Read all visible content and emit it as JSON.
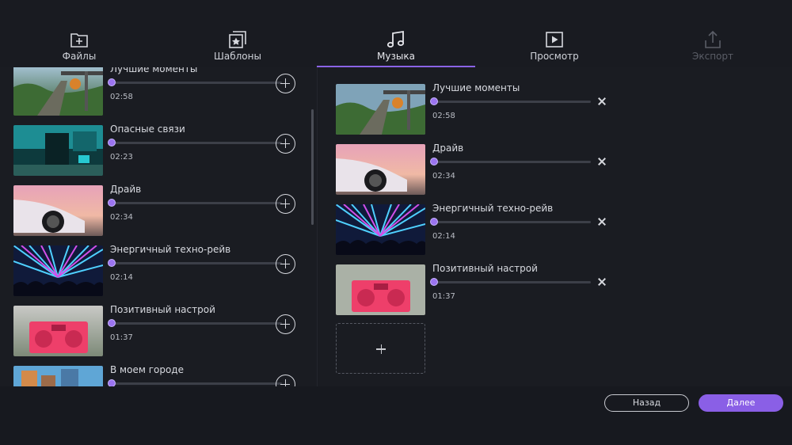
{
  "colors": {
    "accent": "#8a63e6",
    "background": "#17191f",
    "panel": "#1a1c22"
  },
  "tabs": [
    {
      "label": "Файлы",
      "icon": "file-add-icon",
      "state": "normal"
    },
    {
      "label": "Шаблоны",
      "icon": "templates-icon",
      "state": "normal"
    },
    {
      "label": "Музыка",
      "icon": "music-note-icon",
      "state": "active"
    },
    {
      "label": "Просмотр",
      "icon": "play-preview-icon",
      "state": "normal"
    },
    {
      "label": "Экспорт",
      "icon": "export-icon",
      "state": "disabled"
    }
  ],
  "library": {
    "tracks": [
      {
        "title": "Лучшие моменты",
        "duration": "02:58",
        "thumb": "train-thumb",
        "progress": 0
      },
      {
        "title": "Опасные связи",
        "duration": "02:23",
        "thumb": "building-thumb",
        "progress": 0
      },
      {
        "title": "Драйв",
        "duration": "02:34",
        "thumb": "car-thumb",
        "progress": 0
      },
      {
        "title": "Энергичный техно-рейв",
        "duration": "02:14",
        "thumb": "rave-thumb",
        "progress": 0
      },
      {
        "title": "Позитивный настрой",
        "duration": "01:37",
        "thumb": "boombox-thumb",
        "progress": 0
      },
      {
        "title": "В моем городе",
        "duration": "",
        "thumb": "city-thumb",
        "progress": 0
      }
    ]
  },
  "selected": {
    "tracks": [
      {
        "title": "Лучшие моменты",
        "duration": "02:58",
        "thumb": "train-thumb",
        "progress": 0
      },
      {
        "title": "Драйв",
        "duration": "02:34",
        "thumb": "car-thumb",
        "progress": 0
      },
      {
        "title": "Энергичный техно-рейв",
        "duration": "02:14",
        "thumb": "rave-thumb",
        "progress": 0
      },
      {
        "title": "Позитивный настрой",
        "duration": "01:37",
        "thumb": "boombox-thumb",
        "progress": 0
      }
    ]
  },
  "footer": {
    "back_label": "Назад",
    "next_label": "Далее"
  }
}
